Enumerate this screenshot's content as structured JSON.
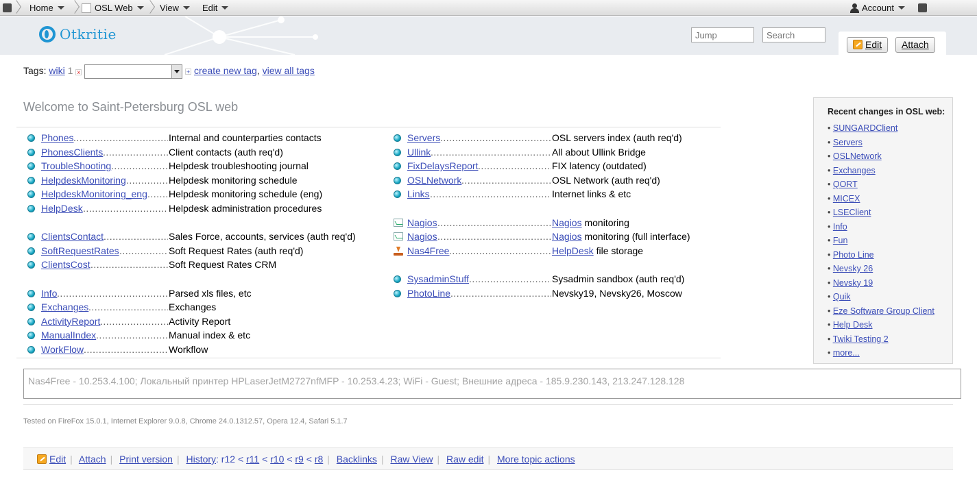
{
  "toolbar": {
    "home": "Home",
    "web": "OSL Web",
    "view": "View",
    "edit": "Edit",
    "account": "Account"
  },
  "header": {
    "logo_text": "Otkritie",
    "jump_placeholder": "Jump",
    "search_placeholder": "Search",
    "edit_button": "Edit",
    "attach_button": "Attach"
  },
  "tags": {
    "label": "Tags:",
    "tag": "wiki",
    "count": "1",
    "create": "create new tag",
    "separator": ",",
    "view_all": "view all tags"
  },
  "page_title": "Welcome to Saint-Petersburg OSL web",
  "left_column": [
    {
      "name": "Phones",
      "desc": "Internal and counterparties contacts",
      "icon": "globe-icon"
    },
    {
      "name": "PhonesClients",
      "desc": "Client contacts (auth req'd)",
      "icon": "globe-icon"
    },
    {
      "name": "TroubleShooting",
      "desc": "Helpdesk troubleshooting journal",
      "icon": "globe-icon"
    },
    {
      "name": "HelpdeskMonitoring",
      "desc": "Helpdesk monitoring schedule",
      "icon": "globe-icon"
    },
    {
      "name": "HelpdeskMonitoring_eng",
      "desc": "Helpdesk monitoring schedule (eng)",
      "icon": "globe-icon"
    },
    {
      "name": "HelpDesk",
      "desc": "Helpdesk administration procedures",
      "icon": "globe-icon"
    },
    null,
    {
      "name": "ClientsContact",
      "desc": "Sales Force, accounts, services (auth req'd)",
      "icon": "globe-icon"
    },
    {
      "name": "SoftRequestRates",
      "desc": "Soft Request Rates (auth req'd)",
      "icon": "globe-icon"
    },
    {
      "name": "ClientsCost",
      "desc": "Soft Request Rates CRM",
      "icon": "globe-icon"
    },
    null,
    {
      "name": "Info",
      "desc": "Parsed xls files, etc",
      "icon": "globe-icon"
    },
    {
      "name": "Exchanges",
      "desc": "Exchanges",
      "icon": "globe-icon"
    },
    {
      "name": "ActivityReport",
      "desc": "Activity Report",
      "icon": "globe-icon"
    },
    {
      "name": "ManualIndex",
      "desc": "Manual index & etc",
      "icon": "globe-icon"
    },
    {
      "name": "WorkFlow",
      "desc": "Workflow",
      "icon": "globe-icon"
    }
  ],
  "right_column": [
    {
      "name": "Servers",
      "desc": "OSL servers index (auth req'd)",
      "icon": "globe-icon"
    },
    {
      "name": "Ullink",
      "desc": "All about Ullink Bridge",
      "icon": "globe-icon"
    },
    {
      "name": "FixDelaysReport",
      "desc": "FIX latency (outdated)",
      "icon": "globe-icon"
    },
    {
      "name": "OSLNetwork",
      "desc": "OSL Network (auth req'd)",
      "icon": "globe-icon"
    },
    {
      "name": "Links",
      "desc": "Internet links & etc",
      "icon": "globe-icon"
    },
    null,
    {
      "name": "Nagios",
      "desc_link": "Nagios",
      "desc": " monitoring",
      "icon": "chart-icon"
    },
    {
      "name": "Nagios",
      "desc_link": "Nagios",
      "desc": " monitoring (full interface)",
      "icon": "chart-icon"
    },
    {
      "name": "Nas4Free",
      "desc_link": "HelpDesk",
      "desc": " file storage",
      "icon": "download-icon"
    },
    null,
    {
      "name": "SysadminStuff",
      "desc": "Sysadmin sandbox (auth req'd)",
      "icon": "globe-icon"
    },
    {
      "name": "PhotoLine",
      "desc": "Nevsky19, Nevsky26, Moscow",
      "icon": "globe-icon"
    }
  ],
  "sidebar": {
    "title": "Recent changes in OSL web:",
    "items": [
      "SUNGARDClient",
      "Servers",
      "OSLNetwork",
      "Exchanges",
      "QORT",
      "MICEX",
      "LSEClient",
      "Info",
      "Fun",
      "Photo Line",
      "Nevsky 26",
      "Nevsky 19",
      "Quik",
      "Eze Software Group Client",
      "Help Desk",
      "Twiki Testing 2",
      "more..."
    ]
  },
  "infobox": "Nas4Free - 10.253.4.100; Локальный принтер HPLaserJetM2727nfMFP - 10.253.4.23; WiFi - Guest; Внешние адреса - 185.9.230.143, 213.247.128.128",
  "tested": "Tested on FireFox 15.0.1, Internet Explorer 9.0.8, Chrome 24.0.1312.57, Opera 12.4, Safari 5.1.7",
  "actions": {
    "edit": "Edit",
    "attach": "Attach",
    "print": "Print version",
    "history": "History",
    "history_rev": ": r12",
    "lt": "<",
    "r11": "r11",
    "r10": "r10",
    "r9": "r9",
    "r8": "r8",
    "backlinks": "Backlinks",
    "raw_view": "Raw View",
    "raw_edit": "Raw edit",
    "more": "More topic actions"
  }
}
